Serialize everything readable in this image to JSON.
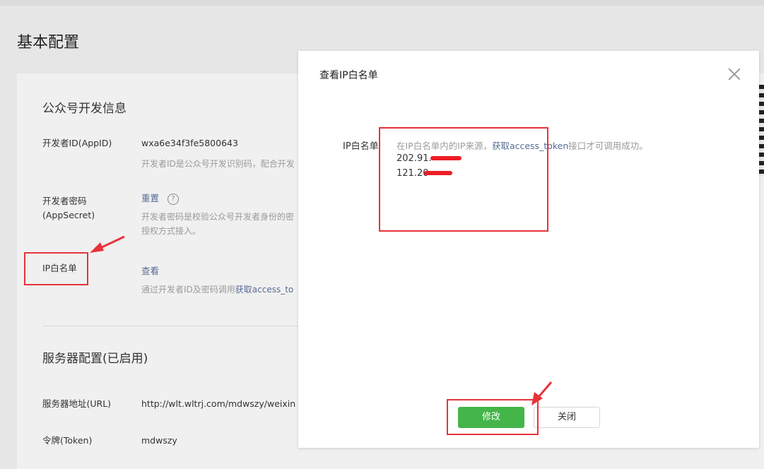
{
  "page": {
    "title": "基本配置"
  },
  "dev_info": {
    "section_title": "公众号开发信息",
    "appid_label": "开发者ID(AppID)",
    "appid_value": "wxa6e34f3fe5800643",
    "appid_desc": "开发者ID是公众号开发识别码，配合开发",
    "secret_label_1": "开发者密码",
    "secret_label_2": "(AppSecret)",
    "secret_action": "重置",
    "secret_desc_1": "开发者密码是校验公众号开发者身份的密",
    "secret_desc_2": "授权方式接入。",
    "ip_label": "IP白名单",
    "ip_action": "查看",
    "ip_desc_prefix": "通过开发者ID及密码调用",
    "ip_desc_link": "获取access_to"
  },
  "server": {
    "section_title": "服务器配置(已启用)",
    "url_label": "服务器地址(URL)",
    "url_value": "http://wlt.wltrj.com/mdwszy/weixin",
    "token_label": "令牌(Token)",
    "token_value": "mdwszy"
  },
  "modal": {
    "title": "查看IP白名单",
    "ip_label": "IP白名单",
    "tip_prefix": "在IP白名单内的IP来源，",
    "tip_link": "获取access_token",
    "tip_suffix": "接口才可调用成功。",
    "ip_1": "202.91.",
    "ip_2": "121.20",
    "modify_button": "修改",
    "close_button": "关闭"
  },
  "colors": {
    "primary": "#44b549",
    "link": "#576b95",
    "annotation": "#e8333a"
  }
}
